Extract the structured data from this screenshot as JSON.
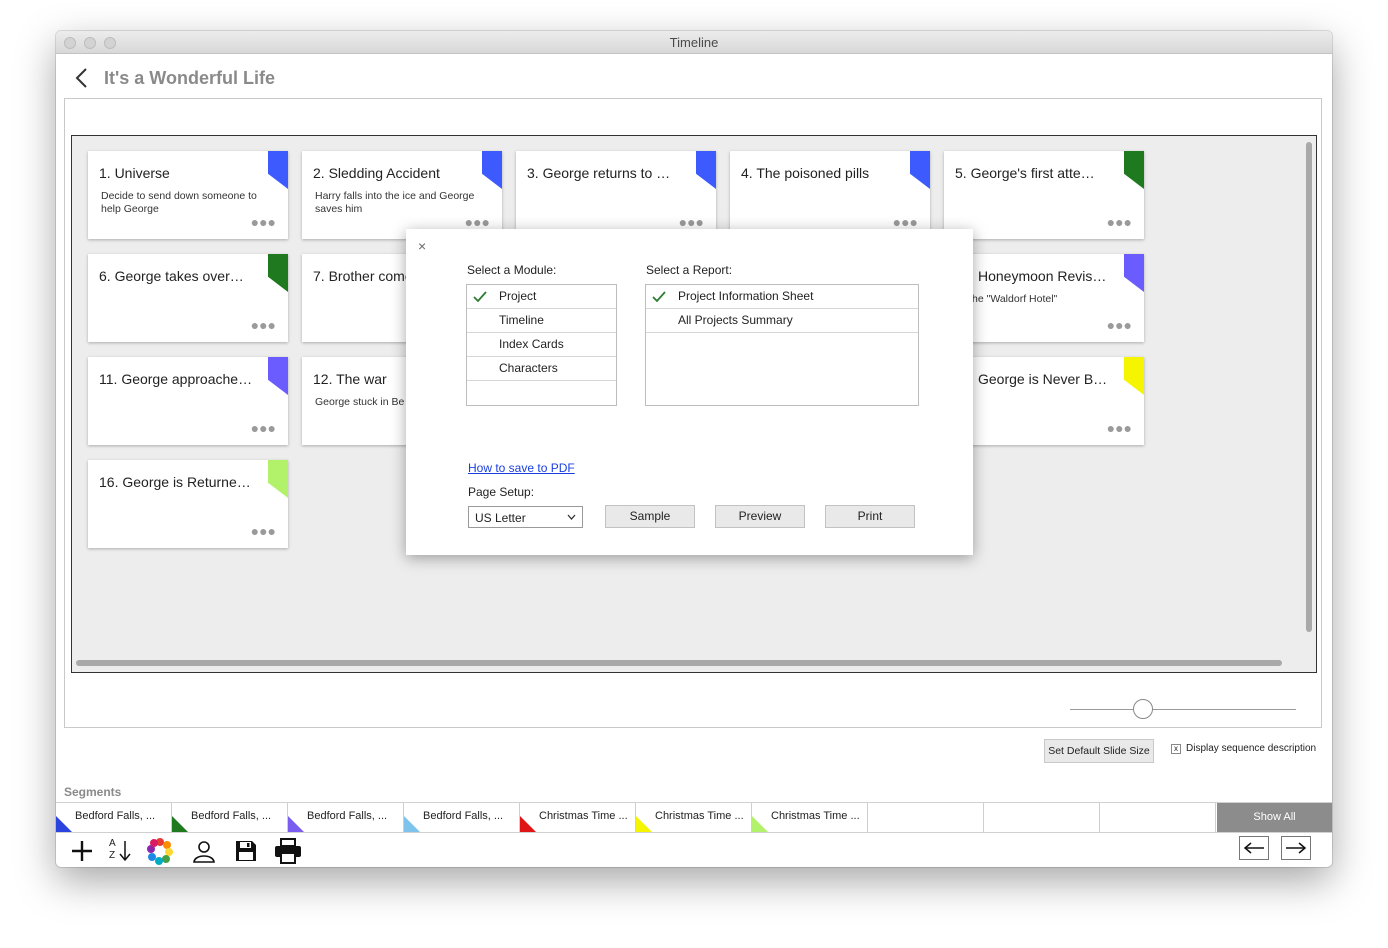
{
  "window": {
    "title": "Timeline"
  },
  "header": {
    "project_title": "It's a Wonderful Life"
  },
  "cards": [
    {
      "title": "1. Universe",
      "description": "Decide to send down someone to help George",
      "flag_color": "#3d5afe"
    },
    {
      "title": "2. Sledding Accident",
      "description": "Harry falls into the ice and George saves him",
      "flag_color": "#3d5afe"
    },
    {
      "title": "3. George returns to …",
      "description": "",
      "flag_color": "#3d5afe"
    },
    {
      "title": "4. The poisoned pills",
      "description": "",
      "flag_color": "#3d5afe"
    },
    {
      "title": "5. George's first atte…",
      "description": "",
      "flag_color": "#1f7a1f"
    },
    {
      "title": "6. George takes over…",
      "description": "",
      "flag_color": "#1f7a1f"
    },
    {
      "title": "7. Brother come",
      "description": "",
      "flag_color": ""
    },
    {
      "title": "Honeymoon Revis…",
      "description": "he \"Waldorf Hotel\"",
      "flag_color": "#6a5cff"
    },
    {
      "title": "11. George approache…",
      "description": "",
      "flag_color": "#6a5cff"
    },
    {
      "title": "12. The war",
      "description": "George stuck in Be",
      "flag_color": ""
    },
    {
      "title": "George is Never B…",
      "description": "",
      "flag_color": "#f5f500"
    },
    {
      "title": "16. George is Returne…",
      "description": "",
      "flag_color": "#b2f26a"
    }
  ],
  "card_dots": "●●●",
  "options": {
    "set_default_slide_size": "Set Default Slide Size",
    "display_sequence_description": "Display sequence description",
    "display_sequence_checked": "x"
  },
  "segments": {
    "label": "Segments",
    "items": [
      {
        "label": "Bedford Falls, ...",
        "color": "#2b44e0"
      },
      {
        "label": "Bedford Falls, ...",
        "color": "#1f7a1f"
      },
      {
        "label": "Bedford Falls, ...",
        "color": "#7a5cf0"
      },
      {
        "label": "Bedford Falls, ...",
        "color": "#7ec3ec"
      },
      {
        "label": "Christmas Time ...",
        "color": "#e01616"
      },
      {
        "label": "Christmas Time ...",
        "color": "#f5f500"
      },
      {
        "label": "Christmas Time ...",
        "color": "#b2f26a"
      },
      {
        "label": "",
        "color": ""
      },
      {
        "label": "",
        "color": ""
      },
      {
        "label": "",
        "color": ""
      }
    ],
    "show_all": "Show All"
  },
  "toolbar": {
    "icons": [
      "plus-icon",
      "sort-az-icon",
      "color-wheel-icon",
      "person-icon",
      "save-icon",
      "print-icon"
    ],
    "az_top": "A",
    "az_bottom": "Z"
  },
  "dialog": {
    "close_glyph": "×",
    "module_label": "Select a Module:",
    "modules": [
      "Project",
      "Timeline",
      "Index Cards",
      "Characters"
    ],
    "selected_module": "Project",
    "report_label": "Select a Report:",
    "reports": [
      "Project Information Sheet",
      "All Projects Summary"
    ],
    "selected_report": "Project Information Sheet",
    "pdf_link": "How to save to PDF",
    "page_setup_label": "Page Setup:",
    "page_setup_value": "US Letter",
    "buttons": {
      "sample": "Sample",
      "preview": "Preview",
      "print": "Print"
    }
  }
}
